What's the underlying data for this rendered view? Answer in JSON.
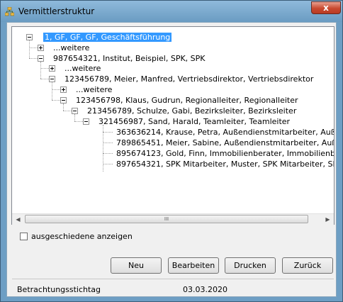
{
  "window": {
    "title": "Vermittlerstruktur",
    "close_symbol": "x",
    "title_icon": "tree-structure-icon"
  },
  "tree": {
    "nodes": [
      {
        "label": "1, GF, GF, GF, Geschäftsführung",
        "selected": true,
        "expander": "minus"
      },
      {
        "label": "...weitere",
        "expander": "plus"
      },
      {
        "label": "987654321, Institut, Beispiel, SPK, SPK",
        "expander": "minus"
      },
      {
        "label": "...weitere",
        "expander": "plus"
      },
      {
        "label": "123456789, Meier, Manfred, Vertriebsdirektor, Vertriebsdirektor",
        "expander": "minus"
      },
      {
        "label": "...weitere",
        "expander": "plus"
      },
      {
        "label": "123456798, Klaus, Gudrun, Regionalleiter, Regionalleiter",
        "expander": "minus"
      },
      {
        "label": "213456789, Schulze, Gabi, Bezirksleiter, Bezirksleiter",
        "expander": "minus"
      },
      {
        "label": "321456987, Sand, Harald, Teamleiter, Teamleiter",
        "expander": "minus"
      },
      {
        "label": "363636214, Krause, Petra, Außendienstmitarbeiter, Außendien",
        "expander": "none"
      },
      {
        "label": "789865451, Meier, Sabine, Außendienstmitarbeiter, Außendiens",
        "expander": "none"
      },
      {
        "label": "895674123, Gold, Finn, Immobilienberater, Immobilienberater",
        "expander": "none"
      },
      {
        "label": "897654321, SPK Mitarbeiter, Muster, SPK Mitarbeiter, SPK Mitar",
        "expander": "none"
      }
    ],
    "scroll_left_arrow": "◀",
    "scroll_right_arrow": "▶",
    "scroll_thumb_grip": "III"
  },
  "options": {
    "show_retired_label": "ausgeschiedene anzeigen",
    "show_retired_checked": false
  },
  "buttons": {
    "new_label": "Neu",
    "edit_label": "Bearbeiten",
    "print_label": "Drucken",
    "back_label": "Zurück"
  },
  "footer": {
    "date_label": "Betrachtungsstichtag",
    "date_value": "03.03.2020"
  }
}
